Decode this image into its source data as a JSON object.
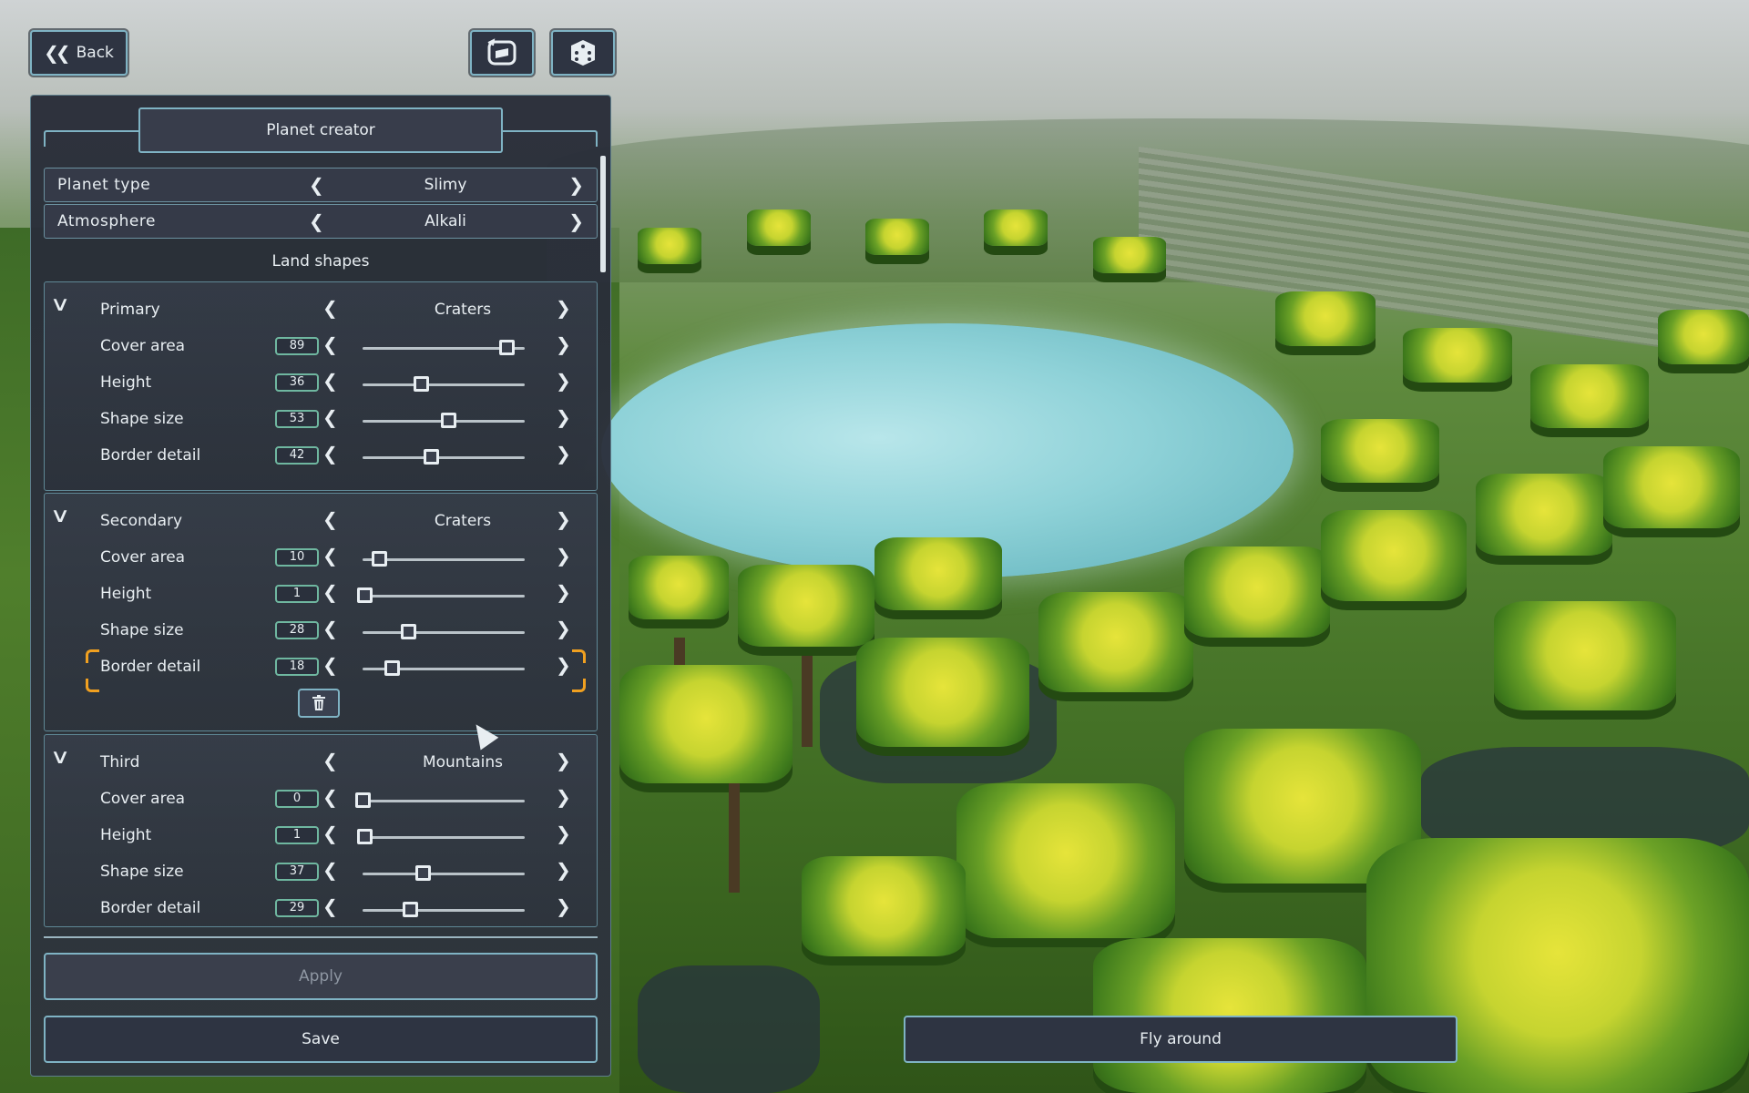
{
  "top_bar": {
    "back_label": "Back"
  },
  "panel": {
    "title": "Planet creator",
    "planet_type": {
      "label": "Planet type",
      "value": "Slimy"
    },
    "atmosphere": {
      "label": "Atmosphere",
      "value": "Alkali"
    },
    "land_shapes_heading": "Land shapes",
    "groups": [
      {
        "name": "Primary",
        "shape": "Craters",
        "props": [
          {
            "label": "Cover area",
            "value": 89
          },
          {
            "label": "Height",
            "value": 36
          },
          {
            "label": "Shape size",
            "value": 53
          },
          {
            "label": "Border detail",
            "value": 42
          }
        ]
      },
      {
        "name": "Secondary",
        "shape": "Craters",
        "props": [
          {
            "label": "Cover area",
            "value": 10
          },
          {
            "label": "Height",
            "value": 1
          },
          {
            "label": "Shape size",
            "value": 28
          },
          {
            "label": "Border detail",
            "value": 18
          }
        ]
      },
      {
        "name": "Third",
        "shape": "Mountains",
        "props": [
          {
            "label": "Cover area",
            "value": 0
          },
          {
            "label": "Height",
            "value": 1
          },
          {
            "label": "Shape size",
            "value": 37
          },
          {
            "label": "Border detail",
            "value": 29
          }
        ]
      }
    ],
    "apply_label": "Apply",
    "save_label": "Save"
  },
  "fly_label": "Fly around",
  "colors": {
    "accent": "#7fb3c4",
    "focus": "#f0a020",
    "number_border": "#6fb7a0"
  }
}
